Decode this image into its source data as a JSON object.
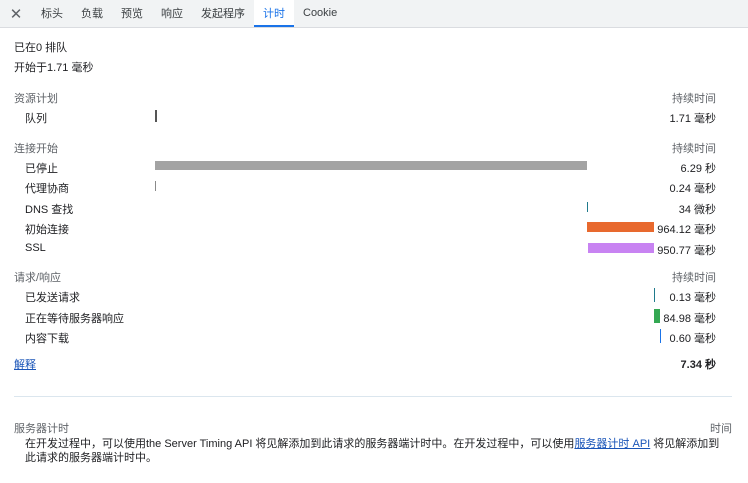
{
  "tabs": [
    {
      "label": "标头"
    },
    {
      "label": "负载"
    },
    {
      "label": "预览"
    },
    {
      "label": "响应"
    },
    {
      "label": "发起程序"
    },
    {
      "label": "计时"
    },
    {
      "label": "Cookie"
    }
  ],
  "active_tab": "计时",
  "summary": {
    "queued": "已在0 排队",
    "started": "开始于1.71  毫秒"
  },
  "resource_schedule": {
    "title": "资源计划",
    "duration_header": "持续时间",
    "rows": [
      {
        "label": "队列",
        "duration": "1.71  毫秒"
      }
    ]
  },
  "connection_start": {
    "title": "连接开始",
    "duration_header": "持续时间",
    "rows": [
      {
        "label": "已停止",
        "duration": "6.29 秒"
      },
      {
        "label": "代理协商",
        "duration": "0.24  毫秒"
      },
      {
        "label": "DNS 查找",
        "duration": "34 微秒"
      },
      {
        "label": "初始连接",
        "duration": "964.12  毫秒"
      },
      {
        "label": "SSL",
        "duration": "950.77  毫秒"
      }
    ]
  },
  "request_response": {
    "title": "请求/响应",
    "duration_header": "持续时间",
    "rows": [
      {
        "label": "已发送请求",
        "duration": "0.13  毫秒"
      },
      {
        "label": "正在等待服务器响应",
        "duration": "84.98  毫秒"
      },
      {
        "label": "内容下载",
        "duration": "0.60  毫秒"
      }
    ]
  },
  "explanation_link": "解释",
  "total": "7.34 秒",
  "server_timing": {
    "title": "服务器计时",
    "time_header": "时间",
    "text_before": "在开发过程中，可以使用the Server Timing API 将见解添加到此请求的服务器端计时中。在开发过程中，可以使用",
    "link": "服务器计时 API",
    "text_after": " 将见解添加到此请求的服务器端计时中。"
  },
  "colors": {
    "stalled": "#a3a3a3",
    "queue": "#555555",
    "proxy": "#8a8a8a",
    "dns": "#1f7a8c",
    "initial_connection": "#e8692e",
    "ssl": "#c883f2",
    "request_sent": "#1f7a8c",
    "waiting": "#34a853",
    "download": "#1a73e8"
  }
}
